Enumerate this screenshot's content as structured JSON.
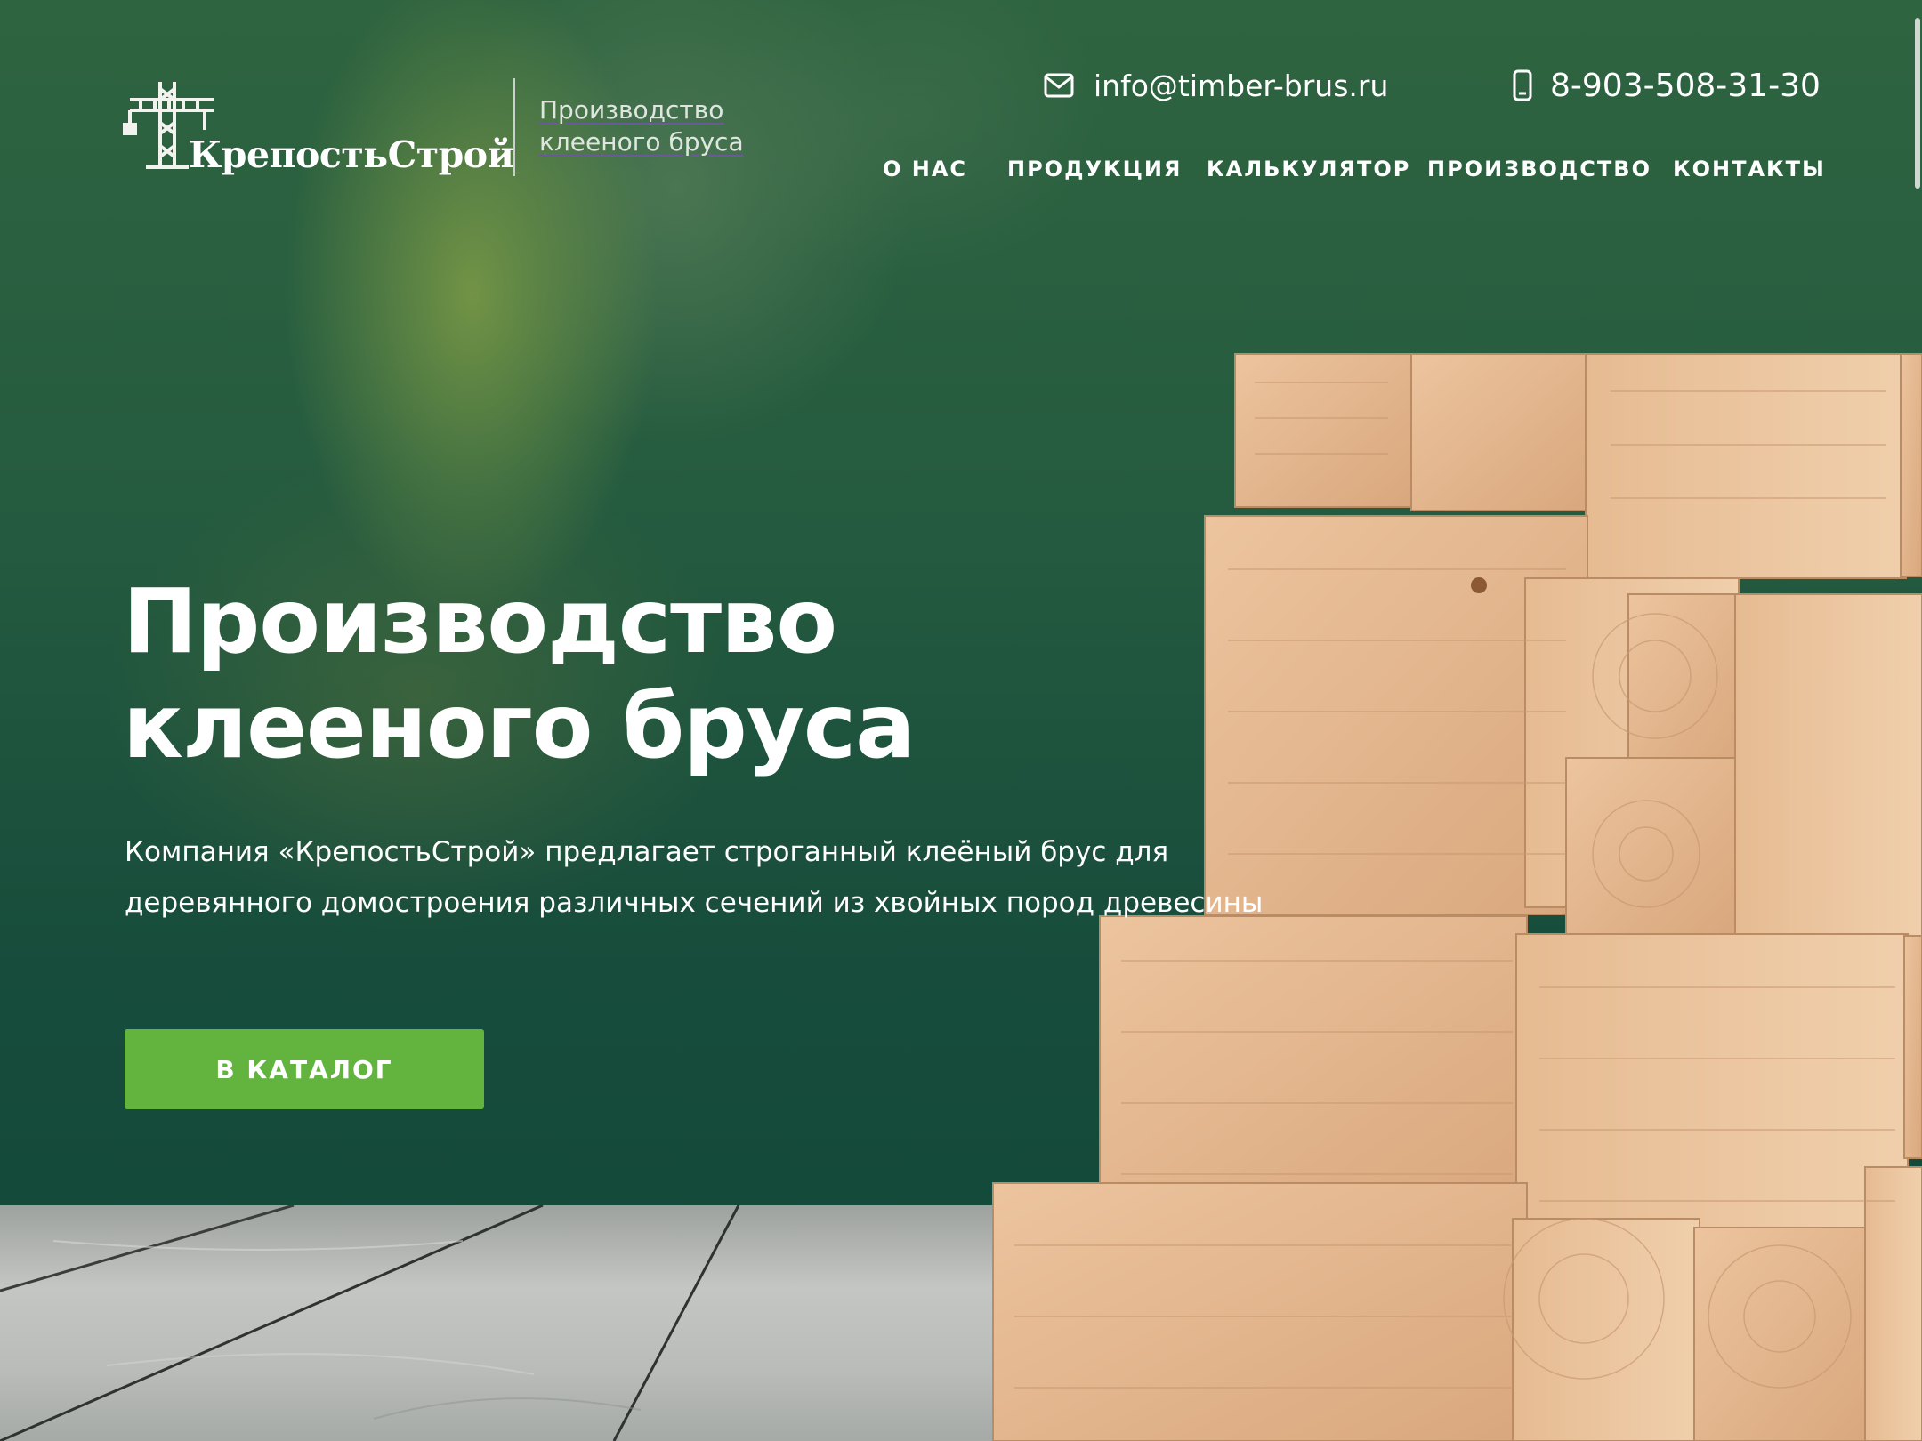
{
  "header": {
    "logo_text": "КрепостьСтрой",
    "tagline_line1": "Производство",
    "tagline_line2": "клееного бруса",
    "email": "info@timber-brus.ru",
    "phone": "8-903-508-31-30"
  },
  "nav": {
    "items": [
      {
        "label": "О НАС"
      },
      {
        "label": "ПРОДУКЦИЯ"
      },
      {
        "label": "КАЛЬКУЛЯТОР"
      },
      {
        "label": "ПРОИЗВОДСТВО"
      },
      {
        "label": "КОНТАКТЫ"
      }
    ]
  },
  "hero": {
    "title_line1": "Производство",
    "title_line2": "клееного бруса",
    "description": "Компания «КрепостьСтрой» предлагает строганный клеёный брус для деревянного домостроения различных сечений из хвойных пород древесины",
    "cta_label": "В КАТАЛОГ"
  },
  "icons": {
    "email": "envelope-icon",
    "phone": "mobile-phone-icon",
    "logo": "tower-crane-icon"
  },
  "colors": {
    "accent": "#62b43e",
    "hero_bg": "#1e5640",
    "timber": "#e2b890"
  }
}
